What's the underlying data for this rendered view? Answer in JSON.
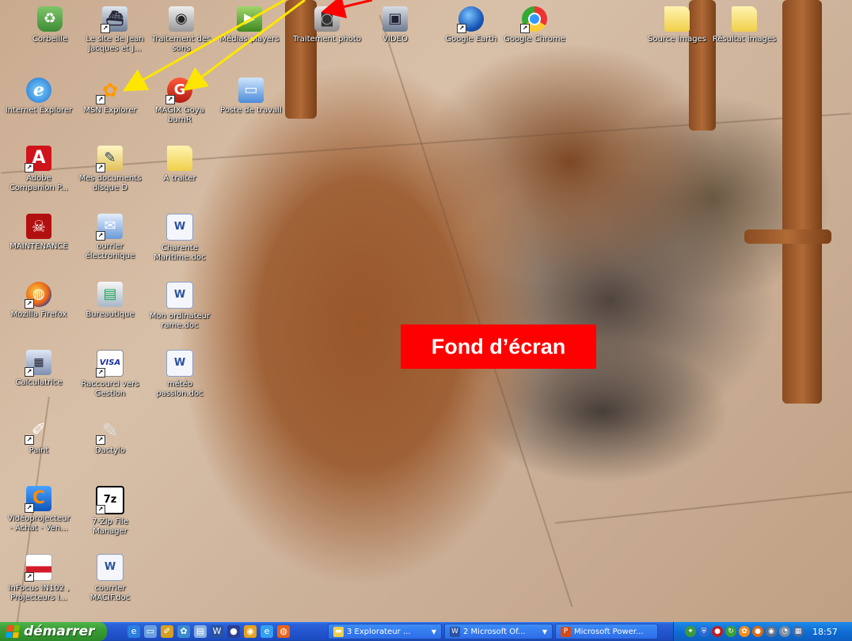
{
  "desktop": {
    "icons": [
      {
        "id": "corbeille",
        "label": "Corbeille",
        "glyph": "♻",
        "icon": "recycle-bin-icon",
        "shortcut": false
      },
      {
        "id": "site-jean-jacques",
        "label": "Le site de Jean jacques et J...",
        "glyph": "⛴",
        "icon": "ship-icon",
        "shortcut": true
      },
      {
        "id": "traitement-sons",
        "label": "Traitement des sons",
        "glyph": "◉",
        "icon": "speaker-icon",
        "shortcut": false
      },
      {
        "id": "medias-players",
        "label": "Médias players",
        "glyph": "▶",
        "icon": "media-player-icon",
        "shortcut": false
      },
      {
        "id": "traitement-photo",
        "label": "Traitement photo",
        "glyph": "◙",
        "icon": "camera-icon",
        "shortcut": false
      },
      {
        "id": "video",
        "label": "VIDEO",
        "glyph": "▣",
        "icon": "video-folder-icon",
        "shortcut": false
      },
      {
        "id": "google-earth",
        "label": "Google Earth",
        "glyph": "",
        "icon": "google-earth-icon",
        "shortcut": true
      },
      {
        "id": "google-chrome",
        "label": "Google Chrome",
        "glyph": "",
        "icon": "google-chrome-icon",
        "shortcut": true
      },
      {
        "id": "source-images",
        "label": "Source images",
        "glyph": "",
        "icon": "folder-icon",
        "shortcut": false
      },
      {
        "id": "resultat-images",
        "label": "Résultat images",
        "glyph": "",
        "icon": "folder-icon",
        "shortcut": false
      },
      {
        "id": "internet-explorer",
        "label": "Internet Explorer",
        "glyph": "e",
        "icon": "internet-explorer-icon",
        "shortcut": false
      },
      {
        "id": "msn-explorer",
        "label": "MSN Explorer",
        "glyph": "✿",
        "icon": "msn-butterfly-icon",
        "shortcut": true
      },
      {
        "id": "magix-goya",
        "label": "MAGIX Goya burnR",
        "glyph": "G",
        "icon": "magix-icon",
        "shortcut": true
      },
      {
        "id": "poste-de-travail",
        "label": "Poste de travail",
        "glyph": "▭",
        "icon": "computer-icon",
        "shortcut": false
      },
      {
        "id": "adobe-companion",
        "label": "Adobe Companion P...",
        "glyph": "A",
        "icon": "adobe-icon",
        "shortcut": true
      },
      {
        "id": "mes-documents",
        "label": "Mes documents disque D",
        "glyph": "✎",
        "icon": "documents-folder-icon",
        "shortcut": true
      },
      {
        "id": "a-traiter",
        "label": "A traiter",
        "glyph": "",
        "icon": "folder-icon",
        "shortcut": false
      },
      {
        "id": "maintenance",
        "label": "MAINTENANCE",
        "glyph": "☠",
        "icon": "skull-icon",
        "shortcut": false
      },
      {
        "id": "courrier-electronique",
        "label": "ourrier électronique",
        "glyph": "✉",
        "icon": "mail-icon",
        "shortcut": true
      },
      {
        "id": "charente-maritime",
        "label": "Charente Maritime.doc",
        "glyph": "W",
        "icon": "word-document-icon",
        "shortcut": false
      },
      {
        "id": "mozilla-firefox",
        "label": "Mozilla Firefox",
        "glyph": "◍",
        "icon": "firefox-icon",
        "shortcut": true
      },
      {
        "id": "bureautique",
        "label": "Bureautique",
        "glyph": "▤",
        "icon": "office-window-icon",
        "shortcut": false
      },
      {
        "id": "mon-ordinateur-rame",
        "label": "Mon ordinateur rame.doc",
        "glyph": "W",
        "icon": "word-document-icon",
        "shortcut": false
      },
      {
        "id": "calculatrice",
        "label": "Calculatrice",
        "glyph": "▦",
        "icon": "calculator-icon",
        "shortcut": true
      },
      {
        "id": "raccourci-gestion",
        "label": "Raccourci vers Gestion",
        "glyph": "VISA",
        "icon": "visa-card-icon",
        "shortcut": true
      },
      {
        "id": "meteo-passion",
        "label": "météo passion.doc",
        "glyph": "W",
        "icon": "word-document-icon",
        "shortcut": false
      },
      {
        "id": "paint",
        "label": "Paint",
        "glyph": "✐",
        "icon": "paint-brushes-icon",
        "shortcut": true
      },
      {
        "id": "dactylo",
        "label": "Dactylo",
        "glyph": "✎",
        "icon": "pencil-icon",
        "shortcut": true
      },
      {
        "id": "videoprojecteur",
        "label": "Vidéoprojecteur - Achat - Ven...",
        "glyph": "C",
        "icon": "web-shortcut-icon",
        "shortcut": true
      },
      {
        "id": "7zip",
        "label": "7-Zip File Manager",
        "glyph": "7z",
        "icon": "7zip-icon",
        "shortcut": true
      },
      {
        "id": "infocus",
        "label": "InFocus IN102 , Projecteurs I...",
        "glyph": "",
        "icon": "infocus-icon",
        "shortcut": true
      },
      {
        "id": "courrier-macif",
        "label": "courrier MACIF.doc",
        "glyph": "W",
        "icon": "word-document-icon",
        "shortcut": false
      }
    ],
    "callout_label": "Fond d’écran"
  },
  "taskbar": {
    "start_label": "démarrer",
    "quick_launch": [
      {
        "icon": "ie-quick-icon",
        "glyph": "e",
        "color": "#2a7fe0"
      },
      {
        "icon": "show-desktop-quick-icon",
        "glyph": "▭",
        "color": "#6aa0e0"
      },
      {
        "icon": "paint-quick-icon",
        "glyph": "✐",
        "color": "#d4a020"
      },
      {
        "icon": "msn-quick-icon",
        "glyph": "✿",
        "color": "#3a8ad0"
      },
      {
        "icon": "notepad-quick-icon",
        "glyph": "▤",
        "color": "#8ab0e0"
      },
      {
        "icon": "word-quick-icon",
        "glyph": "W",
        "color": "#2a52a0"
      },
      {
        "icon": "media-quick-icon",
        "glyph": "●",
        "color": "#2b3f90"
      },
      {
        "icon": "chrome-quick-icon",
        "glyph": "◉",
        "color": "#e6a020"
      },
      {
        "icon": "ie2-quick-icon",
        "glyph": "e",
        "color": "#36a0f0"
      },
      {
        "icon": "firefox-quick-icon",
        "glyph": "◍",
        "color": "#e8641a"
      }
    ],
    "tasks": [
      {
        "label": "3 Explorateur ...",
        "icon": "explorer-folder-icon",
        "glyph": "▬",
        "color": "#f0cf4a",
        "grouped": true
      },
      {
        "label": "2 Microsoft Of...",
        "icon": "word-task-icon",
        "glyph": "W",
        "color": "#2a52a0",
        "grouped": true
      },
      {
        "label": "Microsoft Power...",
        "icon": "powerpoint-task-icon",
        "glyph": "P",
        "color": "#d24a1a",
        "grouped": false
      }
    ],
    "tray": [
      {
        "icon": "network-tray-icon",
        "glyph": "✦",
        "color": "#3c9a3c"
      },
      {
        "icon": "shield-tray-icon",
        "glyph": "⛨",
        "color": "#2a6ad0"
      },
      {
        "icon": "antivirus-tray-icon",
        "glyph": "●",
        "color": "#c41c1c"
      },
      {
        "icon": "sync-tray-icon",
        "glyph": "↻",
        "color": "#3aa03a"
      },
      {
        "icon": "msn-tray-icon",
        "glyph": "✿",
        "color": "#f28c1a"
      },
      {
        "icon": "update-tray-icon",
        "glyph": "●",
        "color": "#e06a10"
      },
      {
        "icon": "disk-tray-icon",
        "glyph": "◉",
        "color": "#5a7090"
      },
      {
        "icon": "speaker-tray-icon",
        "glyph": "◔",
        "color": "#7a8aa0"
      },
      {
        "icon": "calendar-tray-icon",
        "glyph": "▦",
        "color": "#4a6a9a"
      }
    ],
    "clock": "18:57"
  }
}
